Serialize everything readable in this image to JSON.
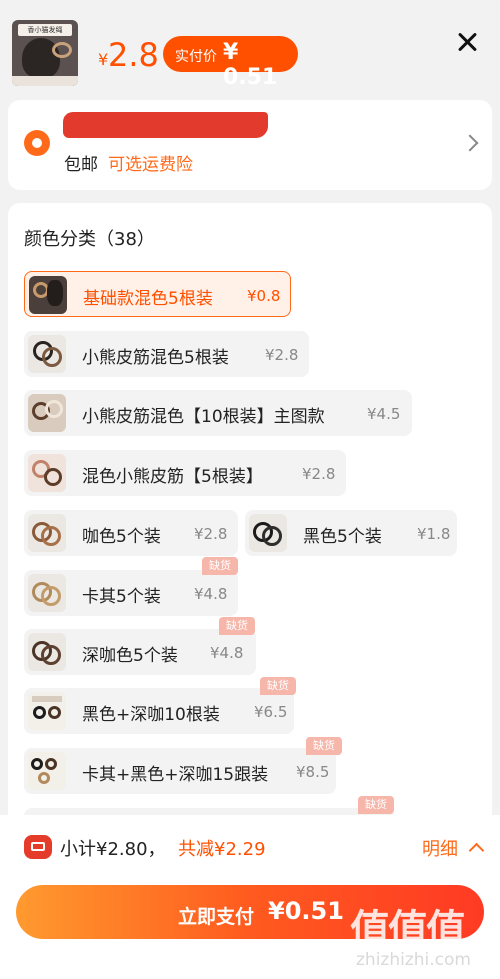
{
  "product": {
    "thumb_banner": "香小猫发绳",
    "price_symbol": "¥",
    "price": "2.8",
    "pay_label": "实付价",
    "pay_amount": "¥ 0.51"
  },
  "address": {
    "redacted": "REDACTED",
    "free_shipping": "包邮",
    "insurance": "可选运费险"
  },
  "options": {
    "title": "颜色分类（38）",
    "out_of_stock": "缺货",
    "items": [
      {
        "name": "基础款混色5根装",
        "price": "¥0.8",
        "selected": true
      },
      {
        "name": "小熊皮筋混色5根装",
        "price": "¥2.8"
      },
      {
        "name": "小熊皮筋混色【10根装】主图款",
        "price": "¥4.5"
      },
      {
        "name": "混色小熊皮筋【5根装】",
        "price": "¥2.8"
      },
      {
        "name": "咖色5个装",
        "price": "¥2.8"
      },
      {
        "name": "黑色5个装",
        "price": "¥1.8"
      },
      {
        "name": "卡其5个装",
        "price": "¥4.8",
        "oos": true
      },
      {
        "name": "深咖色5个装",
        "price": "¥4.8",
        "oos": true
      },
      {
        "name": "黑色+深咖10根装",
        "price": "¥6.5",
        "oos": true
      },
      {
        "name": "卡其+黑色+深咖15跟装",
        "price": "¥8.5",
        "oos": true
      }
    ]
  },
  "footer": {
    "subtotal": "小计¥2.80，",
    "discount": "共减¥2.29",
    "detail": "明细",
    "pay_label": "立即支付",
    "pay_amount": "¥0.51",
    "watermark": "值值值",
    "watermark_url": "zhizhizhi.com"
  },
  "colors": {
    "accent": "#ff5000",
    "brand_red": "#e43b2b",
    "chip_bg": "#f3f3f3",
    "oos_tag": "#f7b6aa"
  }
}
